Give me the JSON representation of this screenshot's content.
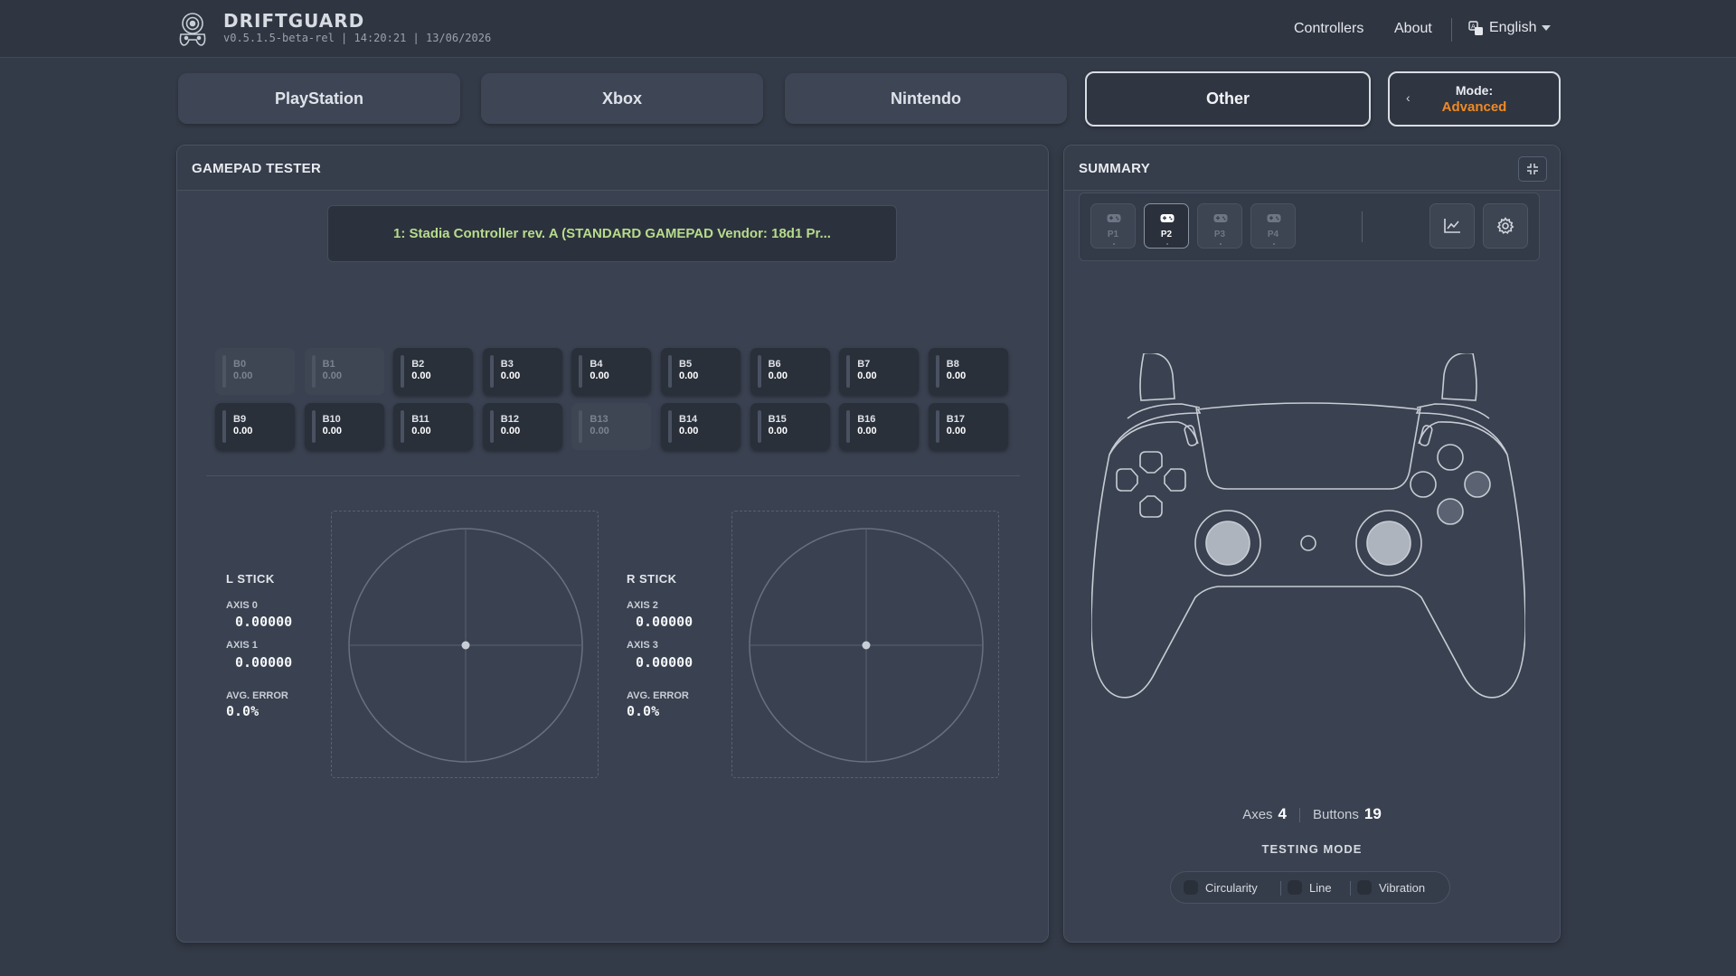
{
  "header": {
    "brand": "DRIFTGUARD",
    "version": "v0.5.1.5-beta-rel | 14:20:21 | 13/06/2026",
    "nav": {
      "controllers": "Controllers",
      "about": "About",
      "language": "English"
    }
  },
  "tabs": [
    {
      "label": "PlayStation",
      "active": false
    },
    {
      "label": "Xbox",
      "active": false
    },
    {
      "label": "Nintendo",
      "active": false
    },
    {
      "label": "Other",
      "active": true
    }
  ],
  "mode": {
    "label": "Mode:",
    "value": "Advanced",
    "chevron": "‹"
  },
  "tester": {
    "title": "GAMEPAD TESTER",
    "device": "1: Stadia Controller rev. A (STANDARD GAMEPAD Vendor: 18d1 Pr...",
    "buttons": [
      {
        "name": "B0",
        "value": "0.00",
        "active": false
      },
      {
        "name": "B1",
        "value": "0.00",
        "active": false
      },
      {
        "name": "B2",
        "value": "0.00",
        "active": true
      },
      {
        "name": "B3",
        "value": "0.00",
        "active": true
      },
      {
        "name": "B4",
        "value": "0.00",
        "active": true
      },
      {
        "name": "B5",
        "value": "0.00",
        "active": true
      },
      {
        "name": "B6",
        "value": "0.00",
        "active": true
      },
      {
        "name": "B7",
        "value": "0.00",
        "active": true
      },
      {
        "name": "B8",
        "value": "0.00",
        "active": true
      },
      {
        "name": "B9",
        "value": "0.00",
        "active": true
      },
      {
        "name": "B10",
        "value": "0.00",
        "active": true
      },
      {
        "name": "B11",
        "value": "0.00",
        "active": true
      },
      {
        "name": "B12",
        "value": "0.00",
        "active": true
      },
      {
        "name": "B13",
        "value": "0.00",
        "active": false
      },
      {
        "name": "B14",
        "value": "0.00",
        "active": true
      },
      {
        "name": "B15",
        "value": "0.00",
        "active": true
      },
      {
        "name": "B16",
        "value": "0.00",
        "active": true
      },
      {
        "name": "B17",
        "value": "0.00",
        "active": true
      }
    ],
    "left_stick": {
      "title": "L STICK",
      "axis_x_label": "AXIS 0",
      "axis_x_value": "0.00000",
      "axis_y_label": "AXIS 1",
      "axis_y_value": "0.00000",
      "error_label": "AVG. ERROR",
      "error_value": "0.0%"
    },
    "right_stick": {
      "title": "R STICK",
      "axis_x_label": "AXIS 2",
      "axis_x_value": "0.00000",
      "axis_y_label": "AXIS 3",
      "axis_y_value": "0.00000",
      "error_label": "AVG. ERROR",
      "error_value": "0.0%"
    }
  },
  "summary": {
    "title": "SUMMARY",
    "players": [
      {
        "label": "P1",
        "active": false
      },
      {
        "label": "P2",
        "active": true
      },
      {
        "label": "P3",
        "active": false
      },
      {
        "label": "P4",
        "active": false
      }
    ],
    "tools": [
      "chart-icon",
      "gear-icon"
    ],
    "axes_label": "Axes",
    "axes_count": "4",
    "buttons_label": "Buttons",
    "buttons_count": "19",
    "testing_mode_title": "TESTING MODE",
    "testing_options": [
      "Circularity",
      "Line",
      "Vibration"
    ]
  },
  "colors": {
    "accent": "#f08a24",
    "device_text": "#b7dc8c",
    "background": "#343b48"
  }
}
